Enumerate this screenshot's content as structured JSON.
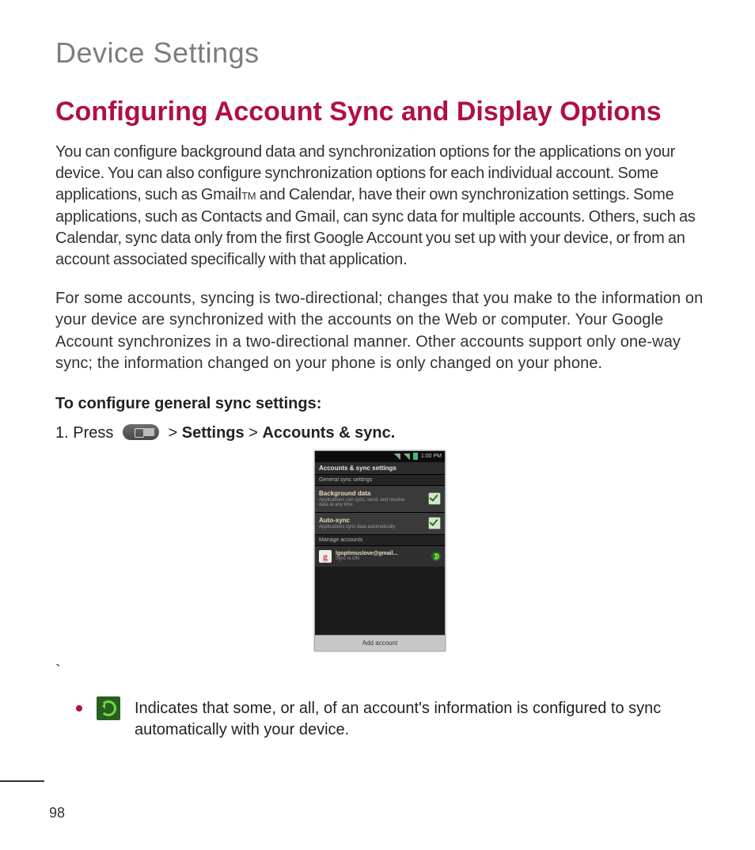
{
  "section_title": "Device Settings",
  "heading": "Configuring Account Sync and Display Options",
  "para1_a": "You can configure background data and synchronization options for the applications on your device. You can also configure synchronization options for each individual account. Some applications, such as Gmail",
  "tm": "TM",
  "para1_b": " and Calendar, have their own synchronization settings. Some applications, such as Contacts and Gmail, can sync data for multiple accounts. Others, such as Calendar, sync data only from the first Google Account you set up with your device, or from an account associated specifically with that application.",
  "para2": "For some accounts, syncing is two-directional; changes that you make to the information on your device are synchronized with the accounts on the Web or computer. Your Google Account synchronizes in a two-directional manner. Other accounts support only one-way sync; the information changed on your phone is only changed on your phone.",
  "subhead": "To configure general sync settings:",
  "step1_prefix": "1. Press ",
  "step1_gt1": " > ",
  "step1_settings": "Settings",
  "step1_gt2": " > ",
  "step1_accounts": "Accounts & sync.",
  "backtick": "`",
  "phone": {
    "clock": "1:00 PM",
    "title": "Accounts & sync settings",
    "general_header": "General sync settings",
    "bg_label": "Background data",
    "bg_sub": "Applications can sync, send, and receive data at any time",
    "auto_label": "Auto-sync",
    "auto_sub": "Applications sync data automatically",
    "manage_header": "Manage accounts",
    "google_g": "g",
    "email": "lgoptimuslove@gmail...",
    "sync_state": "Sync is ON",
    "add_account": "Add account"
  },
  "bullet_text": "Indicates that some, or all, of an account's information is configured to sync automatically with your device.",
  "page_number": "98"
}
